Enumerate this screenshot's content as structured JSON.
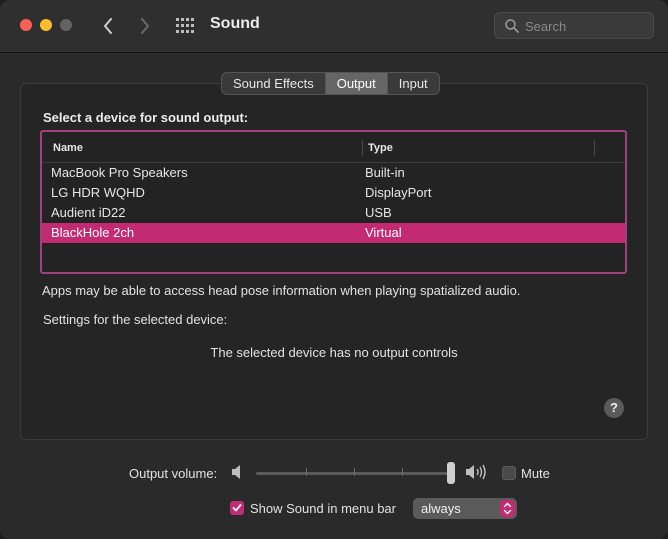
{
  "window": {
    "title": "Sound"
  },
  "search": {
    "placeholder": "Search"
  },
  "tabs": [
    {
      "label": "Sound Effects",
      "active": false
    },
    {
      "label": "Output",
      "active": true
    },
    {
      "label": "Input",
      "active": false
    }
  ],
  "output": {
    "prompt": "Select a device for sound output:",
    "columns": {
      "name": "Name",
      "type": "Type"
    },
    "devices": [
      {
        "name": "MacBook Pro Speakers",
        "type": "Built-in",
        "selected": false
      },
      {
        "name": "LG HDR WQHD",
        "type": "DisplayPort",
        "selected": false
      },
      {
        "name": "Audient iD22",
        "type": "USB",
        "selected": false
      },
      {
        "name": "BlackHole 2ch",
        "type": "Virtual",
        "selected": true
      }
    ],
    "head_pose_note": "Apps may be able to access head pose information when playing spatialized audio.",
    "settings_label": "Settings for the selected device:",
    "no_controls": "The selected device has no output controls",
    "help": "?"
  },
  "footer": {
    "volume_label": "Output volume:",
    "volume_level": 1.0,
    "mute_label": "Mute",
    "mute_checked": false,
    "menubar_label": "Show Sound in menu bar",
    "menubar_checked": true,
    "menubar_option": "always"
  },
  "colors": {
    "accent": "#c22b72",
    "highlight_border": "#a23f7d"
  },
  "icons": [
    "back-icon",
    "forward-icon",
    "grid-icon",
    "search-icon",
    "speaker-low-icon",
    "speaker-high-icon",
    "help-icon",
    "checkmark-icon",
    "updown-arrows-icon"
  ]
}
